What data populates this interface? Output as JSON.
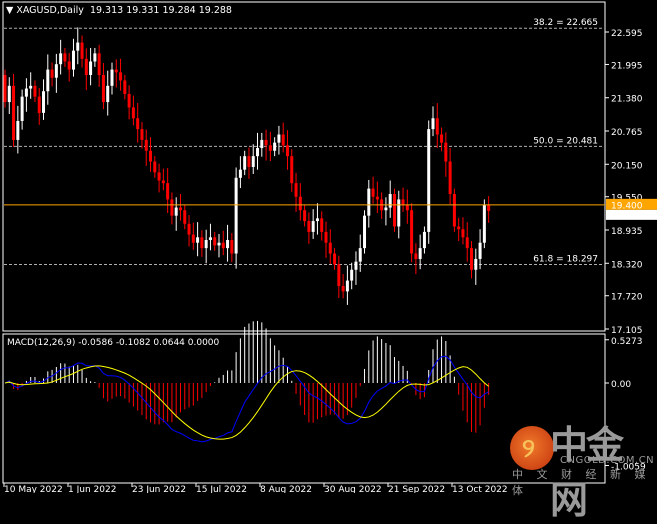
{
  "header": {
    "symbol": "XAGUSD,Daily",
    "ohlc": "19.313 19.331 19.284 19.288"
  },
  "macd": {
    "label": "MACD(12,26,9) -0.0586 -0.1082 0.0644 0.0000",
    "scale_top": "0.5273",
    "scale_zero": "0.00",
    "scale_bottom": "-1.0059"
  },
  "watermark": {
    "name": "中金网",
    "url": "CNGOLD.COM.CN",
    "tagline": "中 文 财 经 新 媒 体"
  },
  "colors": {
    "background": "#000000",
    "bull": "#ffffff",
    "bear": "#ff0000",
    "macd_main": "#0000ff",
    "macd_signal": "#ffff00",
    "current_price": "#ffa500",
    "fib": "#b0b0b0"
  },
  "chart_data": {
    "type": "candlestick",
    "ylim": [
      17.105,
      22.595
    ],
    "ytick_labels": [
      "22.595",
      "21.995",
      "21.380",
      "20.765",
      "20.150",
      "19.550",
      "18.935",
      "18.320",
      "17.720",
      "17.105"
    ],
    "xtick_labels": [
      "10 May 2022",
      "1 Jun 2022",
      "23 Jun 2022",
      "15 Jul 2022",
      "8 Aug 2022",
      "30 Aug 2022",
      "21 Sep 2022",
      "13 Oct 2022"
    ],
    "current_price": {
      "bid": "19.400",
      "last": "19.288"
    },
    "fib_levels": [
      {
        "label": "38.2 = 22.665",
        "value": 22.665
      },
      {
        "label": "50.0 = 20.481",
        "value": 20.481
      },
      {
        "label": "61.8 = 18.297",
        "value": 18.297
      }
    ],
    "closes": [
      21.3,
      21.6,
      20.6,
      20.95,
      21.4,
      21.55,
      21.6,
      21.4,
      21.1,
      21.5,
      21.9,
      21.75,
      22.0,
      22.2,
      22.05,
      21.9,
      22.25,
      22.4,
      22.1,
      21.8,
      22.05,
      22.2,
      21.8,
      21.3,
      21.6,
      21.9,
      21.85,
      21.7,
      21.45,
      21.2,
      21.0,
      20.8,
      20.6,
      20.4,
      20.2,
      20.0,
      19.85,
      19.8,
      19.5,
      19.2,
      19.35,
      19.3,
      19.05,
      18.85,
      18.7,
      18.8,
      18.6,
      18.75,
      18.8,
      18.65,
      18.7,
      18.6,
      18.75,
      18.5,
      19.9,
      20.05,
      20.3,
      20.1,
      20.3,
      20.45,
      20.6,
      20.5,
      20.4,
      20.55,
      20.7,
      20.5,
      20.3,
      19.8,
      19.55,
      19.3,
      19.1,
      18.9,
      19.1,
      19.15,
      18.9,
      18.7,
      18.5,
      18.3,
      17.9,
      17.8,
      18.0,
      18.2,
      18.35,
      18.6,
      19.2,
      19.7,
      19.55,
      19.5,
      19.3,
      19.35,
      19.6,
      19.0,
      19.5,
      19.4,
      19.3,
      18.5,
      18.4,
      18.6,
      18.9,
      20.8,
      21.0,
      20.7,
      20.55,
      20.2,
      19.6,
      19.0,
      18.95,
      18.8,
      18.6,
      18.2,
      18.4,
      18.7,
      19.4,
      19.288
    ],
    "first_open": 21.8,
    "macd_params": [
      12,
      26,
      9
    ]
  }
}
